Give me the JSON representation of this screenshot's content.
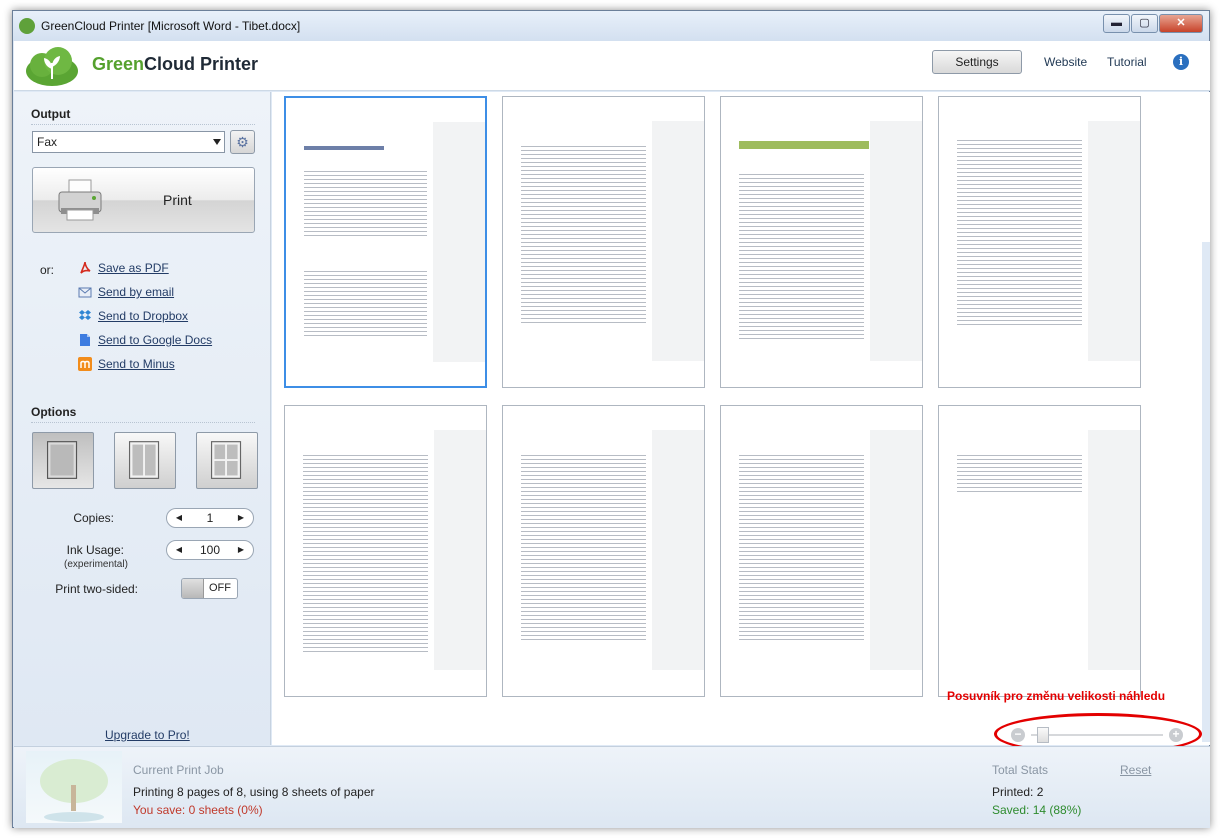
{
  "window": {
    "title": "GreenCloud Printer [Microsoft Word - Tibet.docx]",
    "controls": {
      "minimize": "▬",
      "maximize": "▢",
      "close": "✕"
    }
  },
  "header": {
    "brand_green": "Green",
    "brand_rest": "Cloud Printer",
    "settings_label": "Settings",
    "website_label": "Website",
    "tutorial_label": "Tutorial",
    "info_glyph": "i"
  },
  "output": {
    "title": "Output",
    "printer_selected": "Fax",
    "print_label": "Print",
    "or_label": "or:",
    "share_options": [
      {
        "label": "Save as PDF",
        "icon": "pdf-icon"
      },
      {
        "label": "Send by email",
        "icon": "email-icon"
      },
      {
        "label": "Send to Dropbox",
        "icon": "dropbox-icon"
      },
      {
        "label": "Send to Google Docs",
        "icon": "google-docs-icon"
      },
      {
        "label": "Send to Minus",
        "icon": "minus-icon"
      }
    ]
  },
  "options": {
    "title": "Options",
    "copies_label": "Copies:",
    "copies_value": "1",
    "ink_label": "Ink Usage:",
    "ink_sublabel": "(experimental)",
    "ink_value": "100",
    "two_sided_label": "Print two-sided:",
    "two_sided_value": "OFF",
    "upgrade_label": "Upgrade to Pro!"
  },
  "preview": {
    "page_count": 8,
    "selected_page": 1,
    "annotation": "Posuvník pro změnu velikosti náhledu",
    "zoom_level": 0.05
  },
  "status": {
    "job_title": "Current Print Job",
    "job_line": "Printing 8 pages of 8, using 8 sheets of paper",
    "job_save": "You save: 0 sheets (0%)",
    "stats_title": "Total Stats",
    "reset_label": "Reset",
    "printed": "Printed: 2",
    "saved": "Saved: 14 (88%)"
  },
  "colors": {
    "brand_green": "#55a12e",
    "link_blue": "#233c66",
    "annotation_red": "#e30000",
    "save_red": "#c0392b",
    "saved_green": "#2e8b2e",
    "selected_page": "#3d8ee6"
  }
}
